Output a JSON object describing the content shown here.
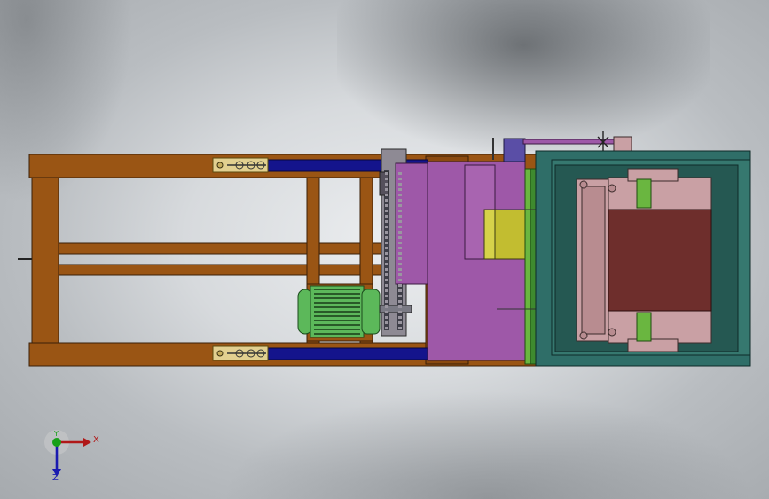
{
  "axes": {
    "x_label": "X",
    "y_label": "Y",
    "z_label": "Z"
  },
  "colors": {
    "frame": "#9a5514",
    "frame_edge": "#3a2008",
    "rail": "#14148c",
    "motor": "#5cb85a",
    "gearbox": "#9e58a8",
    "hopper": "#c2bd30",
    "housing": "#2f6e68",
    "roller": "#6e2e2c",
    "pink": "#c9a0a4"
  }
}
